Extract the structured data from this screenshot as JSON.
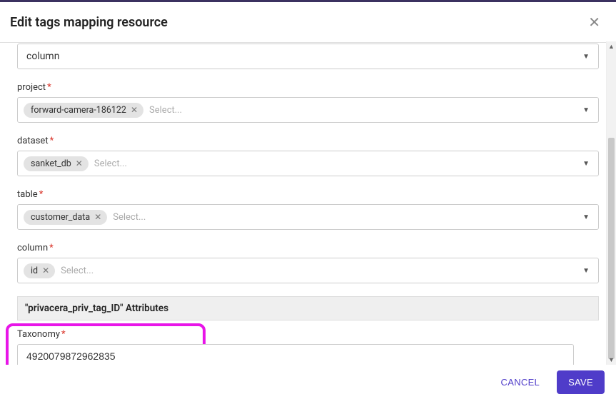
{
  "header": {
    "title": "Edit tags mapping resource"
  },
  "fields": {
    "scope": {
      "value": "column"
    },
    "project": {
      "label": "project",
      "chip": "forward-camera-186122",
      "placeholder": "Select..."
    },
    "dataset": {
      "label": "dataset",
      "chip": "sanket_db",
      "placeholder": "Select..."
    },
    "table": {
      "label": "table",
      "chip": "customer_data",
      "placeholder": "Select..."
    },
    "column": {
      "label": "column",
      "chip": "id",
      "placeholder": "Select..."
    }
  },
  "section": {
    "title": "\"privacera_priv_tag_ID\" Attributes"
  },
  "taxonomy": {
    "label": "Taxonomy",
    "value": "4920079872962835"
  },
  "footer": {
    "cancel": "CANCEL",
    "save": "SAVE"
  }
}
